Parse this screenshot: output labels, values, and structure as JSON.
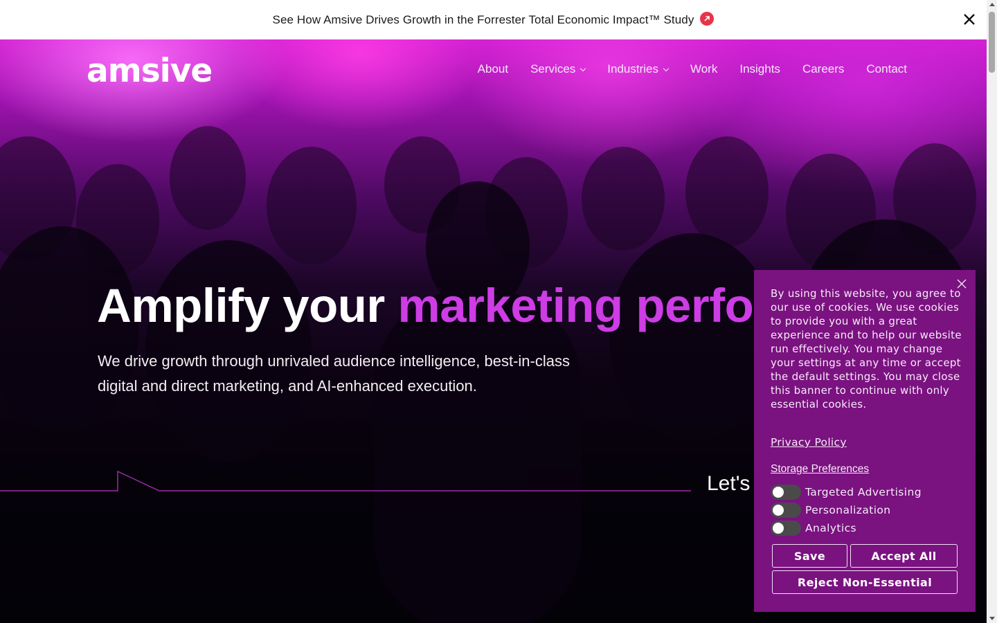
{
  "announcement": {
    "text": "See How Amsive Drives Growth in the Forrester Total Economic Impact™ Study",
    "badge_icon": "arrow-up-right-icon",
    "badge_color": "#e8344a"
  },
  "header": {
    "logo_text": "amsive",
    "nav": [
      {
        "label": "About",
        "has_dropdown": false
      },
      {
        "label": "Services",
        "has_dropdown": true
      },
      {
        "label": "Industries",
        "has_dropdown": true
      },
      {
        "label": "Work",
        "has_dropdown": false
      },
      {
        "label": "Insights",
        "has_dropdown": false
      },
      {
        "label": "Careers",
        "has_dropdown": false
      },
      {
        "label": "Contact",
        "has_dropdown": false
      }
    ]
  },
  "hero": {
    "headline_plain": "Amplify your ",
    "headline_accent": "marketing performance",
    "subhead": "We drive growth through unrivaled audience intelligence, best-in-class digital and direct marketing, and AI-enhanced execution.",
    "cta_partial": "Let's",
    "accent_color": "#cd3ce5"
  },
  "cookie_banner": {
    "message": "By using this website, you agree to our use of cookies. We use cookies to provide you with a great experience and to help our website run effectively. You may change your settings at any time or accept the default settings. You may close this banner to continue with only essential cookies.",
    "privacy_link": "Privacy Policy",
    "prefs_link": "Storage Preferences",
    "toggles": [
      {
        "label": "Targeted Advertising",
        "on": false
      },
      {
        "label": "Personalization",
        "on": false
      },
      {
        "label": "Analytics",
        "on": false
      }
    ],
    "buttons": {
      "save": "Save",
      "accept_all": "Accept All",
      "reject": "Reject Non-Essential"
    },
    "background_color": "#7a1280"
  }
}
